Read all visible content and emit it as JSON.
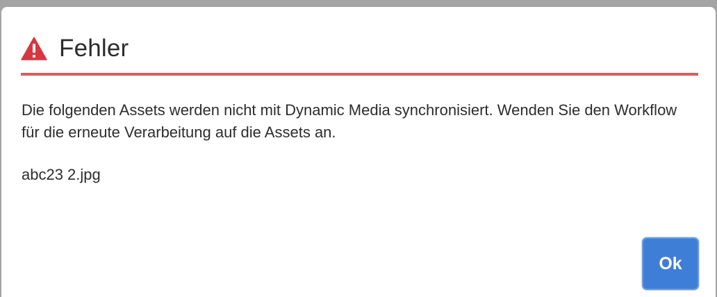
{
  "dialog": {
    "title": "Fehler",
    "icon": "alert-triangle-icon",
    "message": "Die folgenden Assets werden nicht mit Dynamic Media synchronisiert. Wenden Sie den Workflow für die erneute Verarbeitung auf die Assets an.",
    "asset_name": "abc23 2.jpg",
    "ok_label": "Ok"
  },
  "colors": {
    "accent_error": "#d7373f",
    "divider": "#e05b58",
    "button": "#3f7ed6",
    "overlay": "#a4a4a4"
  }
}
